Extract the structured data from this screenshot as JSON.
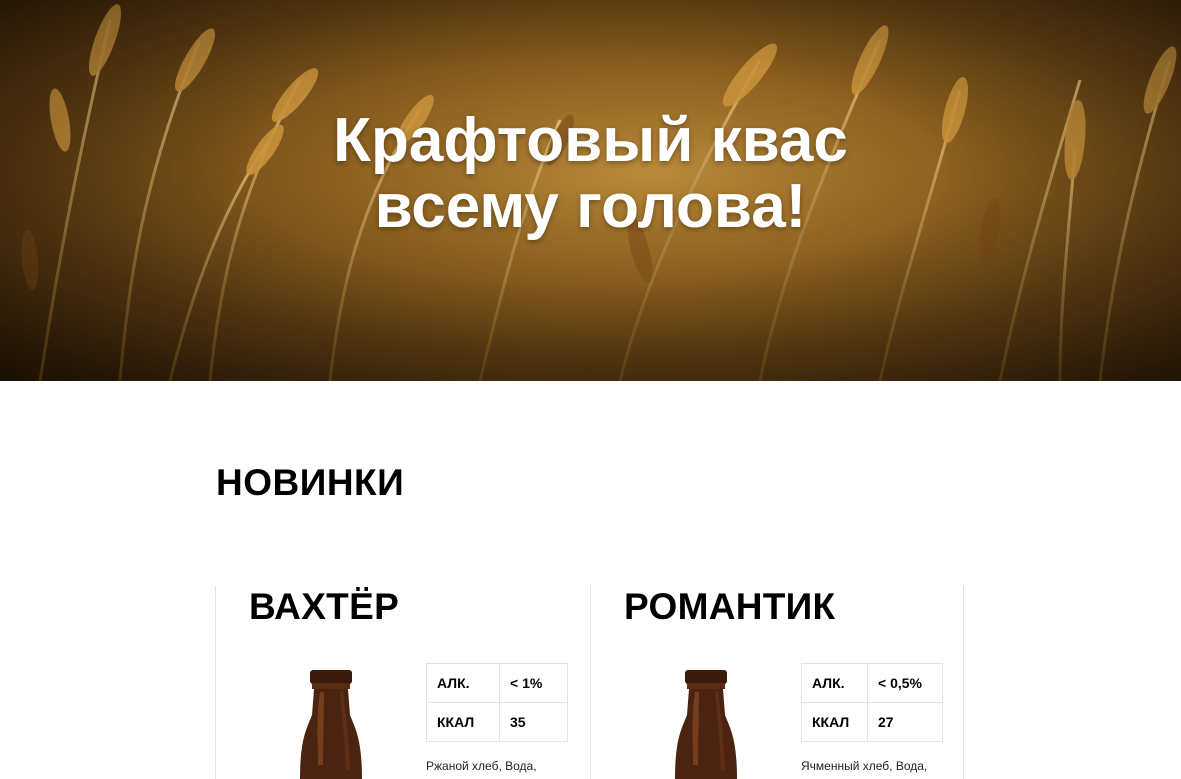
{
  "hero": {
    "title_line1": "Крафтовый квас",
    "title_line2": "всему голова!"
  },
  "section": {
    "title": "НОВИНКИ"
  },
  "products": [
    {
      "name": "ВАХТЁР",
      "specs": [
        {
          "label": "АЛК.",
          "value": "< 1%"
        },
        {
          "label": "ККАЛ",
          "value": "35"
        }
      ],
      "ingredients": "Ржаной хлеб, Вода,"
    },
    {
      "name": "РОМАНТИК",
      "specs": [
        {
          "label": "АЛК.",
          "value": "< 0,5%"
        },
        {
          "label": "ККАЛ",
          "value": "27"
        }
      ],
      "ingredients": "Ячменный хлеб, Вода,"
    }
  ],
  "icons": {
    "hero_image": "wheat-field-photo",
    "product_image": "brown-bottle-photo"
  },
  "colors": {
    "hero_tone": "#8a5e1e",
    "bottle": "#4a2410",
    "border": "#e3e3e3"
  }
}
